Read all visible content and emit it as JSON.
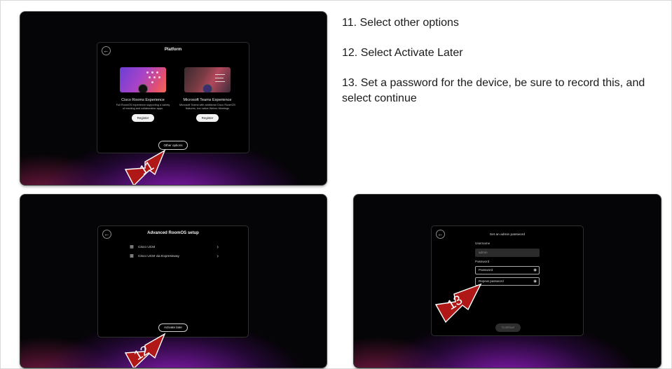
{
  "instructions": {
    "step_11": "11. Select other options",
    "step_12": "12. Select Activate Later",
    "step_13": "13. Set a password for the device, be sure to record this, and select continue"
  },
  "screenshot_1": {
    "title": "Platform",
    "back_icon": "arrow-left-icon",
    "cards": [
      {
        "title": "Cisco Rooms Experience",
        "description": "Full RoomOS experience supporting a variety of meeting and collaboration apps.",
        "button": "Register"
      },
      {
        "title": "Microsoft Teams Experience",
        "description": "Microsoft Teams with additional Cisco RoomOS features, incl native Webex Meetings",
        "button": "Register"
      }
    ],
    "other_options_button": "Other options",
    "callout_number": "11"
  },
  "screenshot_2": {
    "title": "Advanced RoomOS setup",
    "back_icon": "arrow-left-icon",
    "options": [
      {
        "label": "Cisco UCM",
        "icon": "building-icon"
      },
      {
        "label": "Cisco UCM via Expressway",
        "icon": "cloud-building-icon"
      }
    ],
    "activate_later_button": "Activate later",
    "callout_number": "12"
  },
  "screenshot_3": {
    "title": "Set an admin password",
    "back_icon": "arrow-left-icon",
    "username_label": "Username",
    "username_value": "admin",
    "password_label": "Password",
    "password_placeholder": "Password",
    "repeat_password_placeholder": "Repeat password",
    "continue_button": "Continue",
    "callout_number": "13"
  },
  "colors": {
    "callout_arrow": "#b01818",
    "glow_purple": "#9620c8",
    "glow_magenta": "#c82870"
  }
}
